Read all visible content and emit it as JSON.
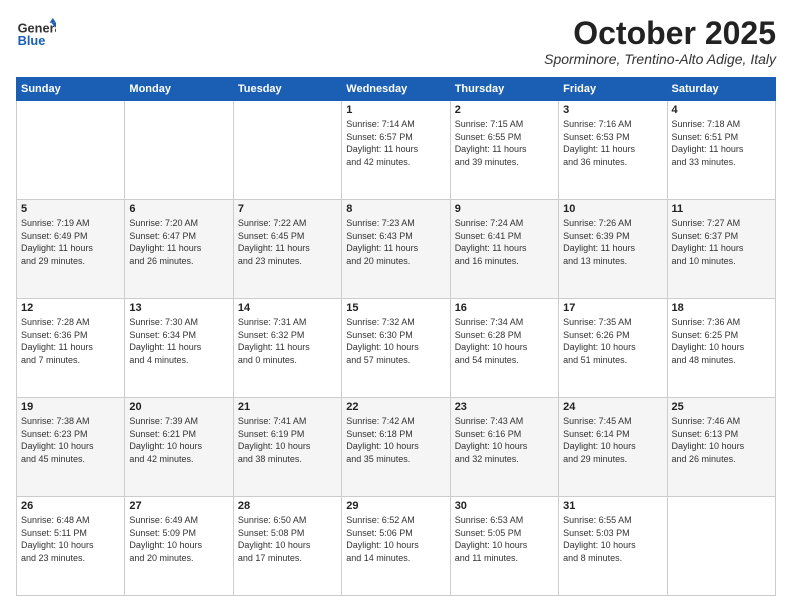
{
  "header": {
    "logo_line1": "General",
    "logo_line2": "Blue",
    "month": "October 2025",
    "location": "Sporminore, Trentino-Alto Adige, Italy"
  },
  "weekdays": [
    "Sunday",
    "Monday",
    "Tuesday",
    "Wednesday",
    "Thursday",
    "Friday",
    "Saturday"
  ],
  "weeks": [
    [
      {
        "day": "",
        "info": ""
      },
      {
        "day": "",
        "info": ""
      },
      {
        "day": "",
        "info": ""
      },
      {
        "day": "1",
        "info": "Sunrise: 7:14 AM\nSunset: 6:57 PM\nDaylight: 11 hours\nand 42 minutes."
      },
      {
        "day": "2",
        "info": "Sunrise: 7:15 AM\nSunset: 6:55 PM\nDaylight: 11 hours\nand 39 minutes."
      },
      {
        "day": "3",
        "info": "Sunrise: 7:16 AM\nSunset: 6:53 PM\nDaylight: 11 hours\nand 36 minutes."
      },
      {
        "day": "4",
        "info": "Sunrise: 7:18 AM\nSunset: 6:51 PM\nDaylight: 11 hours\nand 33 minutes."
      }
    ],
    [
      {
        "day": "5",
        "info": "Sunrise: 7:19 AM\nSunset: 6:49 PM\nDaylight: 11 hours\nand 29 minutes."
      },
      {
        "day": "6",
        "info": "Sunrise: 7:20 AM\nSunset: 6:47 PM\nDaylight: 11 hours\nand 26 minutes."
      },
      {
        "day": "7",
        "info": "Sunrise: 7:22 AM\nSunset: 6:45 PM\nDaylight: 11 hours\nand 23 minutes."
      },
      {
        "day": "8",
        "info": "Sunrise: 7:23 AM\nSunset: 6:43 PM\nDaylight: 11 hours\nand 20 minutes."
      },
      {
        "day": "9",
        "info": "Sunrise: 7:24 AM\nSunset: 6:41 PM\nDaylight: 11 hours\nand 16 minutes."
      },
      {
        "day": "10",
        "info": "Sunrise: 7:26 AM\nSunset: 6:39 PM\nDaylight: 11 hours\nand 13 minutes."
      },
      {
        "day": "11",
        "info": "Sunrise: 7:27 AM\nSunset: 6:37 PM\nDaylight: 11 hours\nand 10 minutes."
      }
    ],
    [
      {
        "day": "12",
        "info": "Sunrise: 7:28 AM\nSunset: 6:36 PM\nDaylight: 11 hours\nand 7 minutes."
      },
      {
        "day": "13",
        "info": "Sunrise: 7:30 AM\nSunset: 6:34 PM\nDaylight: 11 hours\nand 4 minutes."
      },
      {
        "day": "14",
        "info": "Sunrise: 7:31 AM\nSunset: 6:32 PM\nDaylight: 11 hours\nand 0 minutes."
      },
      {
        "day": "15",
        "info": "Sunrise: 7:32 AM\nSunset: 6:30 PM\nDaylight: 10 hours\nand 57 minutes."
      },
      {
        "day": "16",
        "info": "Sunrise: 7:34 AM\nSunset: 6:28 PM\nDaylight: 10 hours\nand 54 minutes."
      },
      {
        "day": "17",
        "info": "Sunrise: 7:35 AM\nSunset: 6:26 PM\nDaylight: 10 hours\nand 51 minutes."
      },
      {
        "day": "18",
        "info": "Sunrise: 7:36 AM\nSunset: 6:25 PM\nDaylight: 10 hours\nand 48 minutes."
      }
    ],
    [
      {
        "day": "19",
        "info": "Sunrise: 7:38 AM\nSunset: 6:23 PM\nDaylight: 10 hours\nand 45 minutes."
      },
      {
        "day": "20",
        "info": "Sunrise: 7:39 AM\nSunset: 6:21 PM\nDaylight: 10 hours\nand 42 minutes."
      },
      {
        "day": "21",
        "info": "Sunrise: 7:41 AM\nSunset: 6:19 PM\nDaylight: 10 hours\nand 38 minutes."
      },
      {
        "day": "22",
        "info": "Sunrise: 7:42 AM\nSunset: 6:18 PM\nDaylight: 10 hours\nand 35 minutes."
      },
      {
        "day": "23",
        "info": "Sunrise: 7:43 AM\nSunset: 6:16 PM\nDaylight: 10 hours\nand 32 minutes."
      },
      {
        "day": "24",
        "info": "Sunrise: 7:45 AM\nSunset: 6:14 PM\nDaylight: 10 hours\nand 29 minutes."
      },
      {
        "day": "25",
        "info": "Sunrise: 7:46 AM\nSunset: 6:13 PM\nDaylight: 10 hours\nand 26 minutes."
      }
    ],
    [
      {
        "day": "26",
        "info": "Sunrise: 6:48 AM\nSunset: 5:11 PM\nDaylight: 10 hours\nand 23 minutes."
      },
      {
        "day": "27",
        "info": "Sunrise: 6:49 AM\nSunset: 5:09 PM\nDaylight: 10 hours\nand 20 minutes."
      },
      {
        "day": "28",
        "info": "Sunrise: 6:50 AM\nSunset: 5:08 PM\nDaylight: 10 hours\nand 17 minutes."
      },
      {
        "day": "29",
        "info": "Sunrise: 6:52 AM\nSunset: 5:06 PM\nDaylight: 10 hours\nand 14 minutes."
      },
      {
        "day": "30",
        "info": "Sunrise: 6:53 AM\nSunset: 5:05 PM\nDaylight: 10 hours\nand 11 minutes."
      },
      {
        "day": "31",
        "info": "Sunrise: 6:55 AM\nSunset: 5:03 PM\nDaylight: 10 hours\nand 8 minutes."
      },
      {
        "day": "",
        "info": ""
      }
    ]
  ]
}
